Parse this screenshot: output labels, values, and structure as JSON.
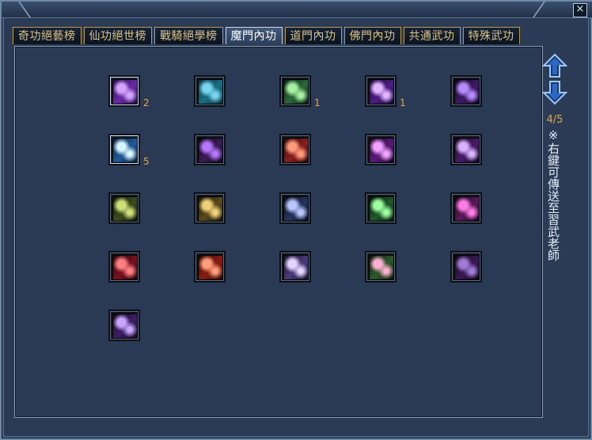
{
  "tabs": [
    {
      "label": "奇功絕藝榜",
      "active": false
    },
    {
      "label": "仙功絕世榜",
      "active": false
    },
    {
      "label": "戰騎絕學榜",
      "active": false
    },
    {
      "label": "魔門內功",
      "active": true
    },
    {
      "label": "道門內功",
      "active": false
    },
    {
      "label": "佛門內功",
      "active": false
    },
    {
      "label": "共通武功",
      "active": false
    },
    {
      "label": "特殊武功",
      "active": false
    }
  ],
  "close_label": "×",
  "pager": {
    "text": "4/5"
  },
  "hint_text": "※右鍵可傳送至習武老師",
  "skills": [
    {
      "count": "2",
      "icon": "purple-fire-icon",
      "colors": [
        "#6b2aa6",
        "#d2a6ff",
        "#2a0b47"
      ]
    },
    {
      "count": "",
      "icon": "teal-wave-icon",
      "colors": [
        "#1b6f84",
        "#78d6f0",
        "#0c3442"
      ]
    },
    {
      "count": "1",
      "icon": "green-figure-icon",
      "colors": [
        "#2b6a3b",
        "#a7f0a1",
        "#0c1f12"
      ]
    },
    {
      "count": "1",
      "icon": "purple-bubbles-icon",
      "colors": [
        "#4d1c86",
        "#e2b6ff",
        "#1b0a2f"
      ]
    },
    {
      "count": "",
      "icon": "purple-claw-icon",
      "colors": [
        "#3e1a66",
        "#b58cff",
        "#12071f"
      ]
    },
    {
      "count": "5",
      "icon": "blue-swirl-icon",
      "colors": [
        "#1f5a9a",
        "#d8f6ff",
        "#0b1f36"
      ]
    },
    {
      "count": "",
      "icon": "purple-demon-icon",
      "colors": [
        "#3a1b55",
        "#b676ff",
        "#12081b"
      ]
    },
    {
      "count": "",
      "icon": "red-slash-icon",
      "colors": [
        "#8a1e1e",
        "#ff9a7a",
        "#2a0909"
      ]
    },
    {
      "count": "",
      "icon": "purple-rain-icon",
      "colors": [
        "#5a1a77",
        "#f0a2ff",
        "#1c0825"
      ]
    },
    {
      "count": "",
      "icon": "purple-pillar-icon",
      "colors": [
        "#4a1a6a",
        "#d7b3ff",
        "#140719"
      ]
    },
    {
      "count": "",
      "icon": "olive-beast-icon",
      "colors": [
        "#3b4c1c",
        "#cfe07a",
        "#131a08"
      ]
    },
    {
      "count": "",
      "icon": "gold-beast-icon",
      "colors": [
        "#5a4a1c",
        "#f0d07a",
        "#1a1407"
      ]
    },
    {
      "count": "",
      "icon": "blue-spiral-icon",
      "colors": [
        "#23345f",
        "#b8c8ff",
        "#0b0f1b"
      ]
    },
    {
      "count": "",
      "icon": "green-skull-icon",
      "colors": [
        "#1f5a2a",
        "#9dff9d",
        "#081a0b"
      ]
    },
    {
      "count": "",
      "icon": "pink-flame-icon",
      "colors": [
        "#5a1a5a",
        "#ff7be6",
        "#1a071a"
      ]
    },
    {
      "count": "",
      "icon": "red-claw-icon",
      "colors": [
        "#7a1020",
        "#ff8080",
        "#24060a"
      ]
    },
    {
      "count": "",
      "icon": "red-blast-icon",
      "colors": [
        "#8a1d12",
        "#ffa07a",
        "#2a0804"
      ]
    },
    {
      "count": "",
      "icon": "purple-cloud-icon",
      "colors": [
        "#4a3a7a",
        "#e1d6ff",
        "#171126"
      ]
    },
    {
      "count": "",
      "icon": "green-aura-icon",
      "colors": [
        "#2c5a2c",
        "#ffb0d0",
        "#0b1a0b"
      ]
    },
    {
      "count": "",
      "icon": "purple-shadow-icon",
      "colors": [
        "#3a1a56",
        "#9f7bd6",
        "#0f0616"
      ]
    },
    {
      "count": "",
      "icon": "purple-ghost-icon",
      "colors": [
        "#3e1e66",
        "#c7a6ff",
        "#12081c"
      ]
    }
  ]
}
